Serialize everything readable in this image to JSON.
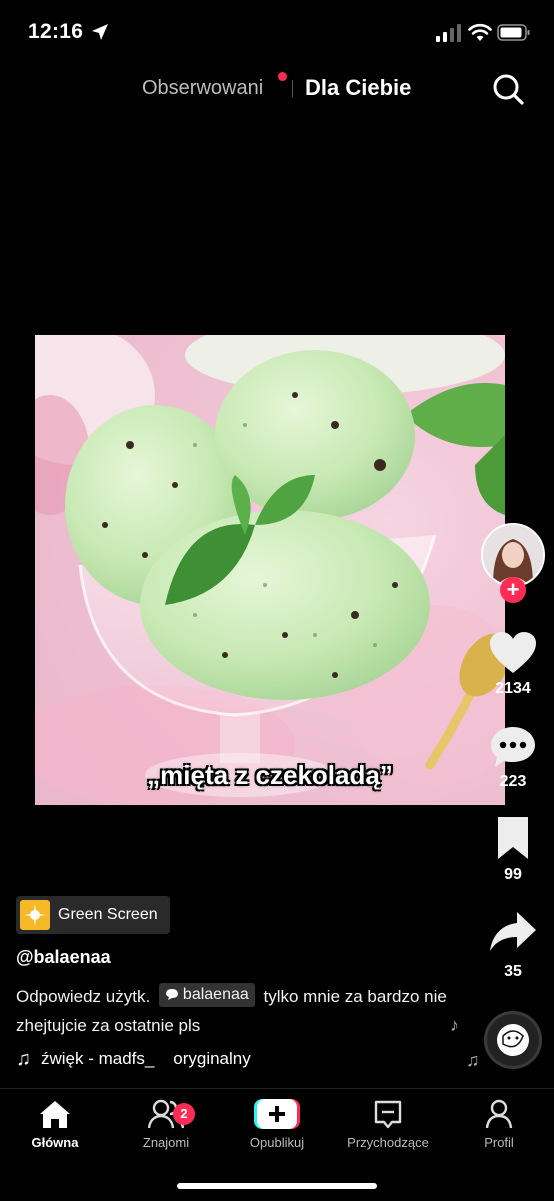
{
  "status_bar": {
    "time": "12:16"
  },
  "top_tabs": {
    "following": "Obserwowani",
    "for_you": "Dla Ciebie"
  },
  "video": {
    "caption": "„mięta z czekoladą”"
  },
  "actions": {
    "likes": "2134",
    "comments": "223",
    "saves": "99",
    "shares": "35"
  },
  "effect": {
    "label": "Green Screen"
  },
  "post": {
    "username": "@balaenaa",
    "description_prefix": "Odpowiedz użytk.",
    "mention": "balaenaa",
    "description_suffix": "tylko mnie za bardzo nie zhejtujcie za ostatnie pls"
  },
  "music": {
    "text": "źwięk - madfs_    oryginalny"
  },
  "nav": {
    "home": "Główna",
    "friends": "Znajomi",
    "friends_badge": "2",
    "post": "Opublikuj",
    "inbox": "Przychodzące",
    "profile": "Profil"
  },
  "colors": {
    "accent": "#fe2c55",
    "cyan": "#25f4ee",
    "chip": "#f5b829"
  }
}
